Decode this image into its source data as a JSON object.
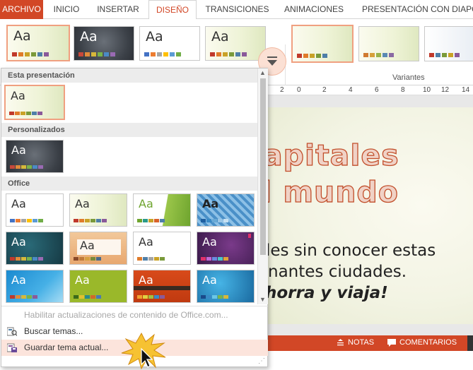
{
  "ribbon": {
    "tabs": [
      {
        "label": "ARCHIVO",
        "kind": "file"
      },
      {
        "label": "INICIO"
      },
      {
        "label": "INSERTAR"
      },
      {
        "label": "DISEÑO",
        "kind": "active"
      },
      {
        "label": "TRANSICIONES"
      },
      {
        "label": "ANIMACIONES"
      },
      {
        "label": "PRESENTACIÓN CON DIAPOS"
      }
    ],
    "themes_preview_label": "Aa",
    "variants_label": "Variantes",
    "accent_color": "#d24726"
  },
  "ruler": {
    "ticks": [
      "2",
      "0",
      "2",
      "4",
      "6",
      "8",
      "10",
      "12",
      "14"
    ]
  },
  "slide": {
    "title_line1": "apitales",
    "title_line2": "l mundo",
    "body_line1": "les sin conocer estas",
    "body_line2": "nantes ciudades.",
    "body_line3": "horra y viaja!"
  },
  "statusbar": {
    "notes_label": "NOTAS",
    "comments_label": "COMENTARIOS"
  },
  "panel": {
    "section_this": "Esta presentación",
    "section_custom": "Personalizados",
    "section_office": "Office",
    "theme_label": "Aa",
    "cmd_enable_updates": "Habilitar actualizaciones de contenido de Office.com...",
    "cmd_search": "Buscar temas...",
    "cmd_save": "Guardar tema actual..."
  },
  "colors": {
    "swatch_row": [
      "#c0392b",
      "#e07b2a",
      "#c9a227",
      "#7a9a3a",
      "#4f7fa8",
      "#8a5a9a"
    ],
    "selection_border": "#f0a080"
  }
}
